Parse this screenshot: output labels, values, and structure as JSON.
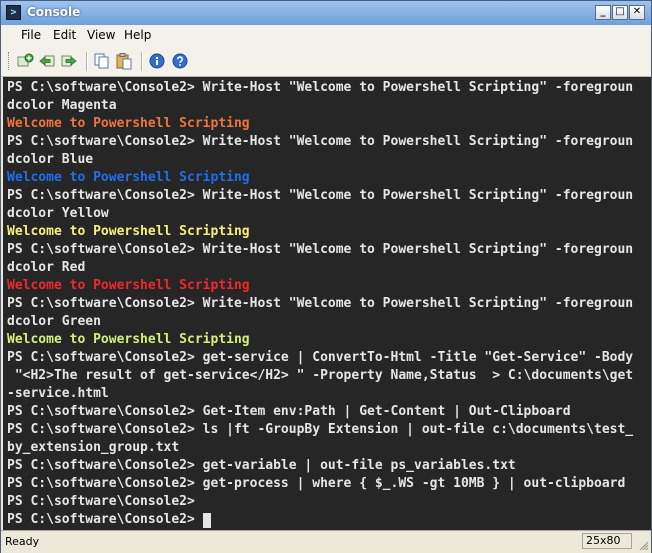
{
  "window": {
    "title": "Console",
    "app_icon_glyph": ">",
    "minimize_glyph": "_",
    "maximize_glyph": "□",
    "close_glyph": "✕"
  },
  "menu": [
    "File",
    "Edit",
    "View",
    "Help"
  ],
  "toolbar": {
    "icons": [
      "new-tab-icon",
      "back-icon",
      "forward-icon",
      "copy-icon",
      "paste-icon",
      "info-icon",
      "help-icon"
    ]
  },
  "console": {
    "background": "#262626",
    "lines": [
      {
        "text": "PS C:\\software\\Console2> Write-Host \"Welcome to Powershell Scripting\" -foregroun",
        "color": "#e6e6e6"
      },
      {
        "text": "dcolor Magenta",
        "color": "#e6e6e6"
      },
      {
        "text": "Welcome to Powershell Scripting",
        "color": "#f0743c"
      },
      {
        "text": "PS C:\\software\\Console2> Write-Host \"Welcome to Powershell Scripting\" -foregroun",
        "color": "#e6e6e6"
      },
      {
        "text": "dcolor Blue",
        "color": "#e6e6e6"
      },
      {
        "text": "Welcome to Powershell Scripting",
        "color": "#1e6ef0"
      },
      {
        "text": "PS C:\\software\\Console2> Write-Host \"Welcome to Powershell Scripting\" -foregroun",
        "color": "#e6e6e6"
      },
      {
        "text": "dcolor Yellow",
        "color": "#e6e6e6"
      },
      {
        "text": "Welcome to Powershell Scripting",
        "color": "#f5f07c"
      },
      {
        "text": "PS C:\\software\\Console2> Write-Host \"Welcome to Powershell Scripting\" -foregroun",
        "color": "#e6e6e6"
      },
      {
        "text": "dcolor Red",
        "color": "#e6e6e6"
      },
      {
        "text": "Welcome to Powershell Scripting",
        "color": "#f02828"
      },
      {
        "text": "PS C:\\software\\Console2> Write-Host \"Welcome to Powershell Scripting\" -foregroun",
        "color": "#e6e6e6"
      },
      {
        "text": "dcolor Green",
        "color": "#e6e6e6"
      },
      {
        "text": "Welcome to Powershell Scripting",
        "color": "#d4f07a"
      },
      {
        "text": "PS C:\\software\\Console2> get-service | ConvertTo-Html -Title \"Get-Service\" -Body",
        "color": "#e6e6e6"
      },
      {
        "text": " \"<H2>The result of get-service</H2> \" -Property Name,Status  > C:\\documents\\get",
        "color": "#e6e6e6"
      },
      {
        "text": "-service.html",
        "color": "#e6e6e6"
      },
      {
        "text": "PS C:\\software\\Console2> Get-Item env:Path | Get-Content | Out-Clipboard",
        "color": "#e6e6e6"
      },
      {
        "text": "PS C:\\software\\Console2> ls |ft -GroupBy Extension | out-file c:\\documents\\test_",
        "color": "#e6e6e6"
      },
      {
        "text": "by_extension_group.txt",
        "color": "#e6e6e6"
      },
      {
        "text": "PS C:\\software\\Console2> get-variable | out-file ps_variables.txt",
        "color": "#e6e6e6"
      },
      {
        "text": "PS C:\\software\\Console2> get-process | where { $_.WS -gt 10MB } | out-clipboard",
        "color": "#e6e6e6"
      },
      {
        "text": "PS C:\\software\\Console2>",
        "color": "#e6e6e6"
      },
      {
        "text": "PS C:\\software\\Console2> ",
        "color": "#e6e6e6",
        "cursor": true
      }
    ]
  },
  "status": {
    "text": "Ready",
    "size": "25x80"
  }
}
